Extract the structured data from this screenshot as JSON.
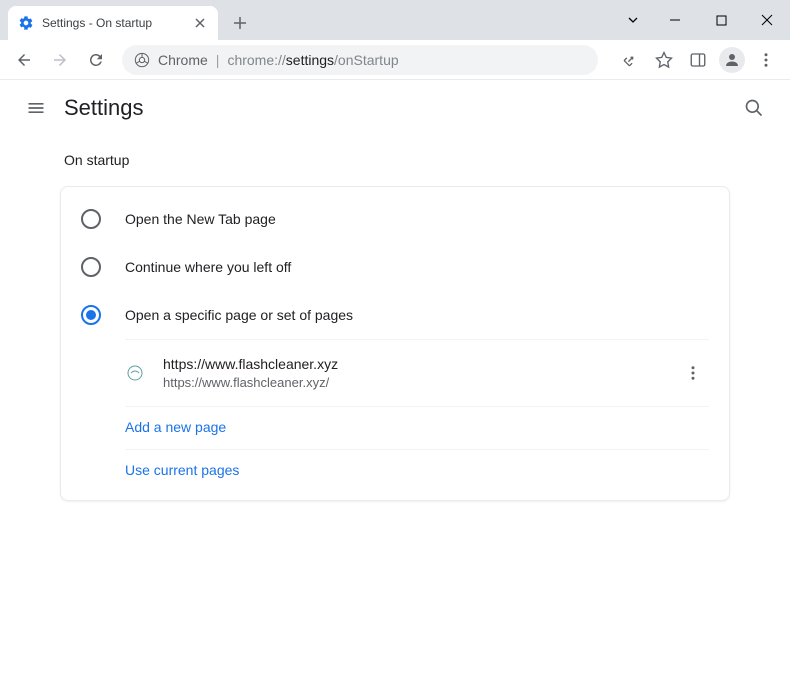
{
  "tab": {
    "title": "Settings - On startup"
  },
  "omnibox": {
    "scheme": "Chrome",
    "path_dim": "chrome://",
    "path_main": "settings",
    "path_tail": "/onStartup"
  },
  "header": {
    "title": "Settings"
  },
  "section": {
    "title": "On startup"
  },
  "options": [
    {
      "label": "Open the New Tab page",
      "selected": false
    },
    {
      "label": "Continue where you left off",
      "selected": false
    },
    {
      "label": "Open a specific page or set of pages",
      "selected": true
    }
  ],
  "pages": [
    {
      "title": "https://www.flashcleaner.xyz",
      "url": "https://www.flashcleaner.xyz/"
    }
  ],
  "links": {
    "add": "Add a new page",
    "current": "Use current pages"
  }
}
